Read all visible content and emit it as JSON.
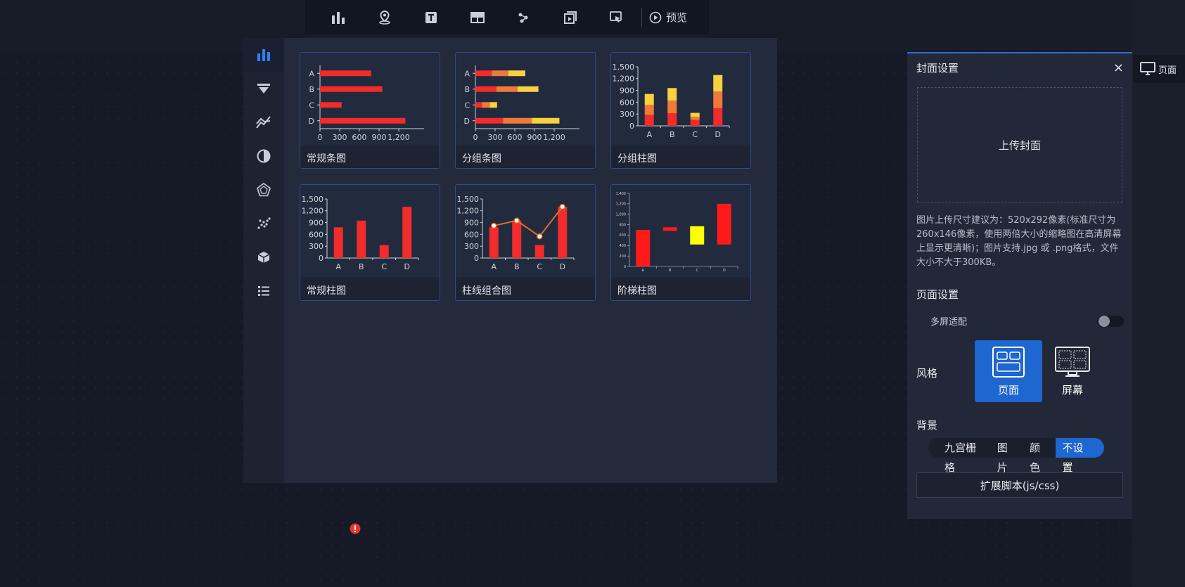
{
  "toolbar": {
    "icons": [
      "chart-icon",
      "map-pin-icon",
      "text-icon",
      "table-icon",
      "network-icon",
      "media-icon",
      "interaction-icon"
    ],
    "preview_label": "预览"
  },
  "sidebar": {
    "items": [
      "bar-chart-icon",
      "funnel-icon",
      "line-chart-icon",
      "pie-chart-icon",
      "radar-icon",
      "scatter-icon",
      "cube-icon",
      "list-icon"
    ]
  },
  "charts": [
    {
      "label": "常规条图",
      "chart_data": {
        "type": "bar",
        "orientation": "horizontal",
        "categories": [
          "A",
          "B",
          "C",
          "D"
        ],
        "values": [
          780,
          950,
          330,
          1300
        ],
        "xticks": [
          "0",
          "300",
          "600",
          "900",
          "1,200"
        ],
        "xlim": [
          0,
          1500
        ]
      }
    },
    {
      "label": "分组条图",
      "chart_data": {
        "type": "bar",
        "orientation": "horizontal",
        "stacked": true,
        "categories": [
          "A",
          "B",
          "C",
          "D"
        ],
        "series": [
          {
            "values": [
              250,
              320,
              100,
              420
            ]
          },
          {
            "values": [
              250,
              320,
              120,
              440
            ]
          },
          {
            "values": [
              260,
              320,
              110,
              420
            ]
          }
        ],
        "xticks": [
          "0",
          "300",
          "600",
          "900",
          "1,200"
        ],
        "xlim": [
          0,
          1500
        ]
      }
    },
    {
      "label": "分组柱图",
      "chart_data": {
        "type": "bar",
        "stacked": true,
        "categories": [
          "A",
          "B",
          "C",
          "D"
        ],
        "series": [
          {
            "values": [
              280,
              320,
              150,
              450
            ]
          },
          {
            "values": [
              250,
              320,
              80,
              420
            ]
          },
          {
            "values": [
              280,
              320,
              100,
              420
            ]
          }
        ],
        "yticks": [
          "0",
          "300",
          "600",
          "900",
          "1,200",
          "1,500"
        ],
        "ylim": [
          0,
          1500
        ]
      }
    },
    {
      "label": "常规柱图",
      "chart_data": {
        "type": "bar",
        "categories": [
          "A",
          "B",
          "C",
          "D"
        ],
        "values": [
          780,
          950,
          330,
          1300
        ],
        "yticks": [
          "0",
          "300",
          "600",
          "900",
          "1,200",
          "1,500"
        ],
        "ylim": [
          0,
          1500
        ]
      }
    },
    {
      "label": "柱线组合图",
      "chart_data": {
        "type": "bar",
        "categories": [
          "A",
          "B",
          "C",
          "D"
        ],
        "series": [
          {
            "type": "bar",
            "values": [
              780,
              950,
              330,
              1300
            ]
          },
          {
            "type": "line",
            "values": [
              820,
              950,
              550,
              1300
            ]
          }
        ],
        "yticks": [
          "0",
          "300",
          "600",
          "900",
          "1,200",
          "1,500"
        ],
        "ylim": [
          0,
          1500
        ]
      }
    },
    {
      "label": "阶梯柱图",
      "chart_data": {
        "type": "bar",
        "waterfall": true,
        "categories": [
          "A",
          "B",
          "C",
          "D"
        ],
        "ranges": [
          [
            0,
            700
          ],
          [
            680,
            750
          ],
          [
            420,
            770
          ],
          [
            420,
            1200
          ]
        ],
        "range_colors": [
          "#ff1a1a",
          "#ff1a1a",
          "#ffff00",
          "#ff1a1a"
        ],
        "yticks": [
          "0",
          "200",
          "400",
          "600",
          "800",
          "1,000",
          "1,200",
          "1,400"
        ],
        "ylim": [
          0,
          1400
        ]
      }
    }
  ],
  "colors": {
    "bar": "#f22b2b",
    "stack2": "#ee7a3a",
    "stack3": "#f8d040",
    "line": "#e86a30",
    "accent": "#1e66d0",
    "axis": "#cfd3da"
  },
  "settings": {
    "title": "封面设置",
    "close_label": "×",
    "upload_label": "上传封面",
    "hint": "图片上传尺寸建议为：520x292像素(标准尺寸为260x146像素，使用两倍大小的缩略图在高清屏幕上显示更清晰)；图片支持.jpg 或 .png格式，文件大小不大于300KB。",
    "page_settings_title": "页面设置",
    "multi_screen_label": "多屏适配",
    "multi_screen_on": false,
    "style_label": "风格",
    "style_options": [
      "页面",
      "屏幕"
    ],
    "style_selected": "页面",
    "background_label": "背景",
    "background_options": [
      "九宫栅格",
      "图片",
      "颜色",
      "不设置"
    ],
    "background_selected": "不设置",
    "ext_script_label": "扩展脚本(js/css)"
  },
  "page_tab_label": "页面"
}
